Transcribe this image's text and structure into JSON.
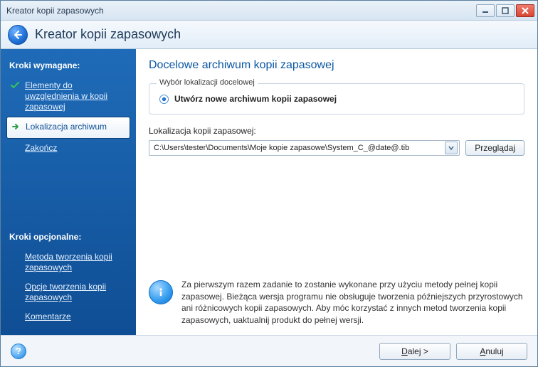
{
  "window": {
    "title": "Kreator kopii zapasowych",
    "heading": "Kreator kopii zapasowych"
  },
  "sidebar": {
    "required_title": "Kroki wymagane:",
    "optional_title": "Kroki opcjonalne:",
    "required_steps": [
      {
        "label": "Elementy do uwzględnienia w kopii zapasowej",
        "status": "done"
      },
      {
        "label": "Lokalizacja archiwum",
        "status": "active"
      },
      {
        "label": "Zakończ",
        "status": "pending"
      }
    ],
    "optional_steps": [
      {
        "label": "Metoda tworzenia kopii zapasowych"
      },
      {
        "label": "Opcje tworzenia kopii zapasowych"
      },
      {
        "label": "Komentarze"
      }
    ]
  },
  "main": {
    "heading": "Docelowe archiwum kopii zapasowej",
    "groupbox_title": "Wybór lokalizacji docelowej",
    "radio_create_new": "Utwórz nowe archiwum kopii zapasowej",
    "location_label": "Lokalizacja kopii zapasowej:",
    "location_value": "C:\\Users\\tester\\Documents\\Moje kopie zapasowe\\System_C_@date@.tib",
    "browse_button": "Przeglądaj",
    "info_text": "Za pierwszym razem zadanie to zostanie wykonane przy użyciu metody pełnej kopii zapasowej. Bieżąca wersja programu nie obsługuje tworzenia późniejszych przyrostowych ani różnicowych kopii zapasowych. Aby móc korzystać z innych metod tworzenia kopii zapasowych, uaktualnij produkt do pełnej wersji."
  },
  "footer": {
    "next_prefix": "D",
    "next_rest": "alej >",
    "cancel_prefix": "A",
    "cancel_rest": "nuluj"
  }
}
